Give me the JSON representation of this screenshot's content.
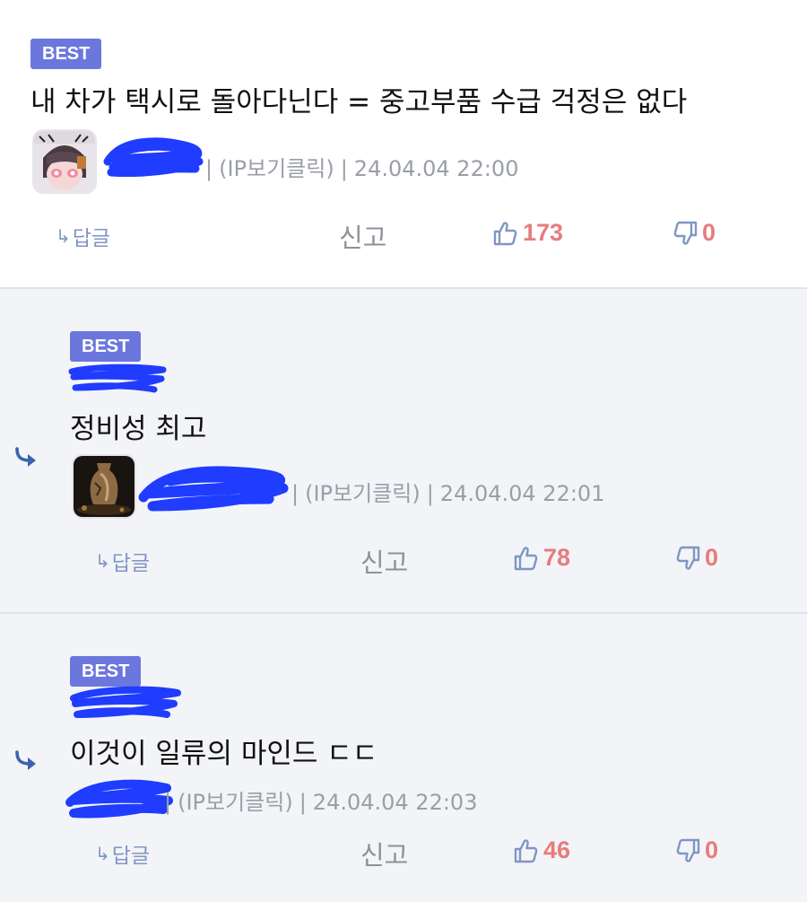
{
  "comments": [
    {
      "badge": "BEST",
      "text": "내 차가 택시로 돌아다닌다 = 중고부품 수급 걱정은 없다",
      "ip": "(IP보기클릭)",
      "date": "24.04.04 22:00",
      "actions": {
        "reply": "답글",
        "report": "신고",
        "likes": "173",
        "dislikes": "0"
      }
    },
    {
      "badge": "BEST",
      "text": "정비성 최고",
      "ip": "(IP보기클릭)",
      "date": "24.04.04 22:01",
      "actions": {
        "reply": "답글",
        "report": "신고",
        "likes": "78",
        "dislikes": "0"
      }
    },
    {
      "badge": "BEST",
      "text": "이것이 일류의 마인드 ㄷㄷ",
      "ip": "(IP보기클릭)",
      "date": "24.04.04 22:03",
      "actions": {
        "reply": "답글",
        "report": "신고",
        "likes": "46",
        "dislikes": "0"
      }
    }
  ],
  "colors": {
    "badge": "#6c77dd",
    "count": "#e77c7c",
    "icon": "#7f96c4",
    "redaction": "#1f3cff",
    "reply_background": "#f3f4f7"
  },
  "icons": {
    "reply_indent": "reply-indent-arrow-icon",
    "reply": "reply-arrow-icon",
    "like": "thumbs-up-icon",
    "dislike": "thumbs-down-icon"
  }
}
